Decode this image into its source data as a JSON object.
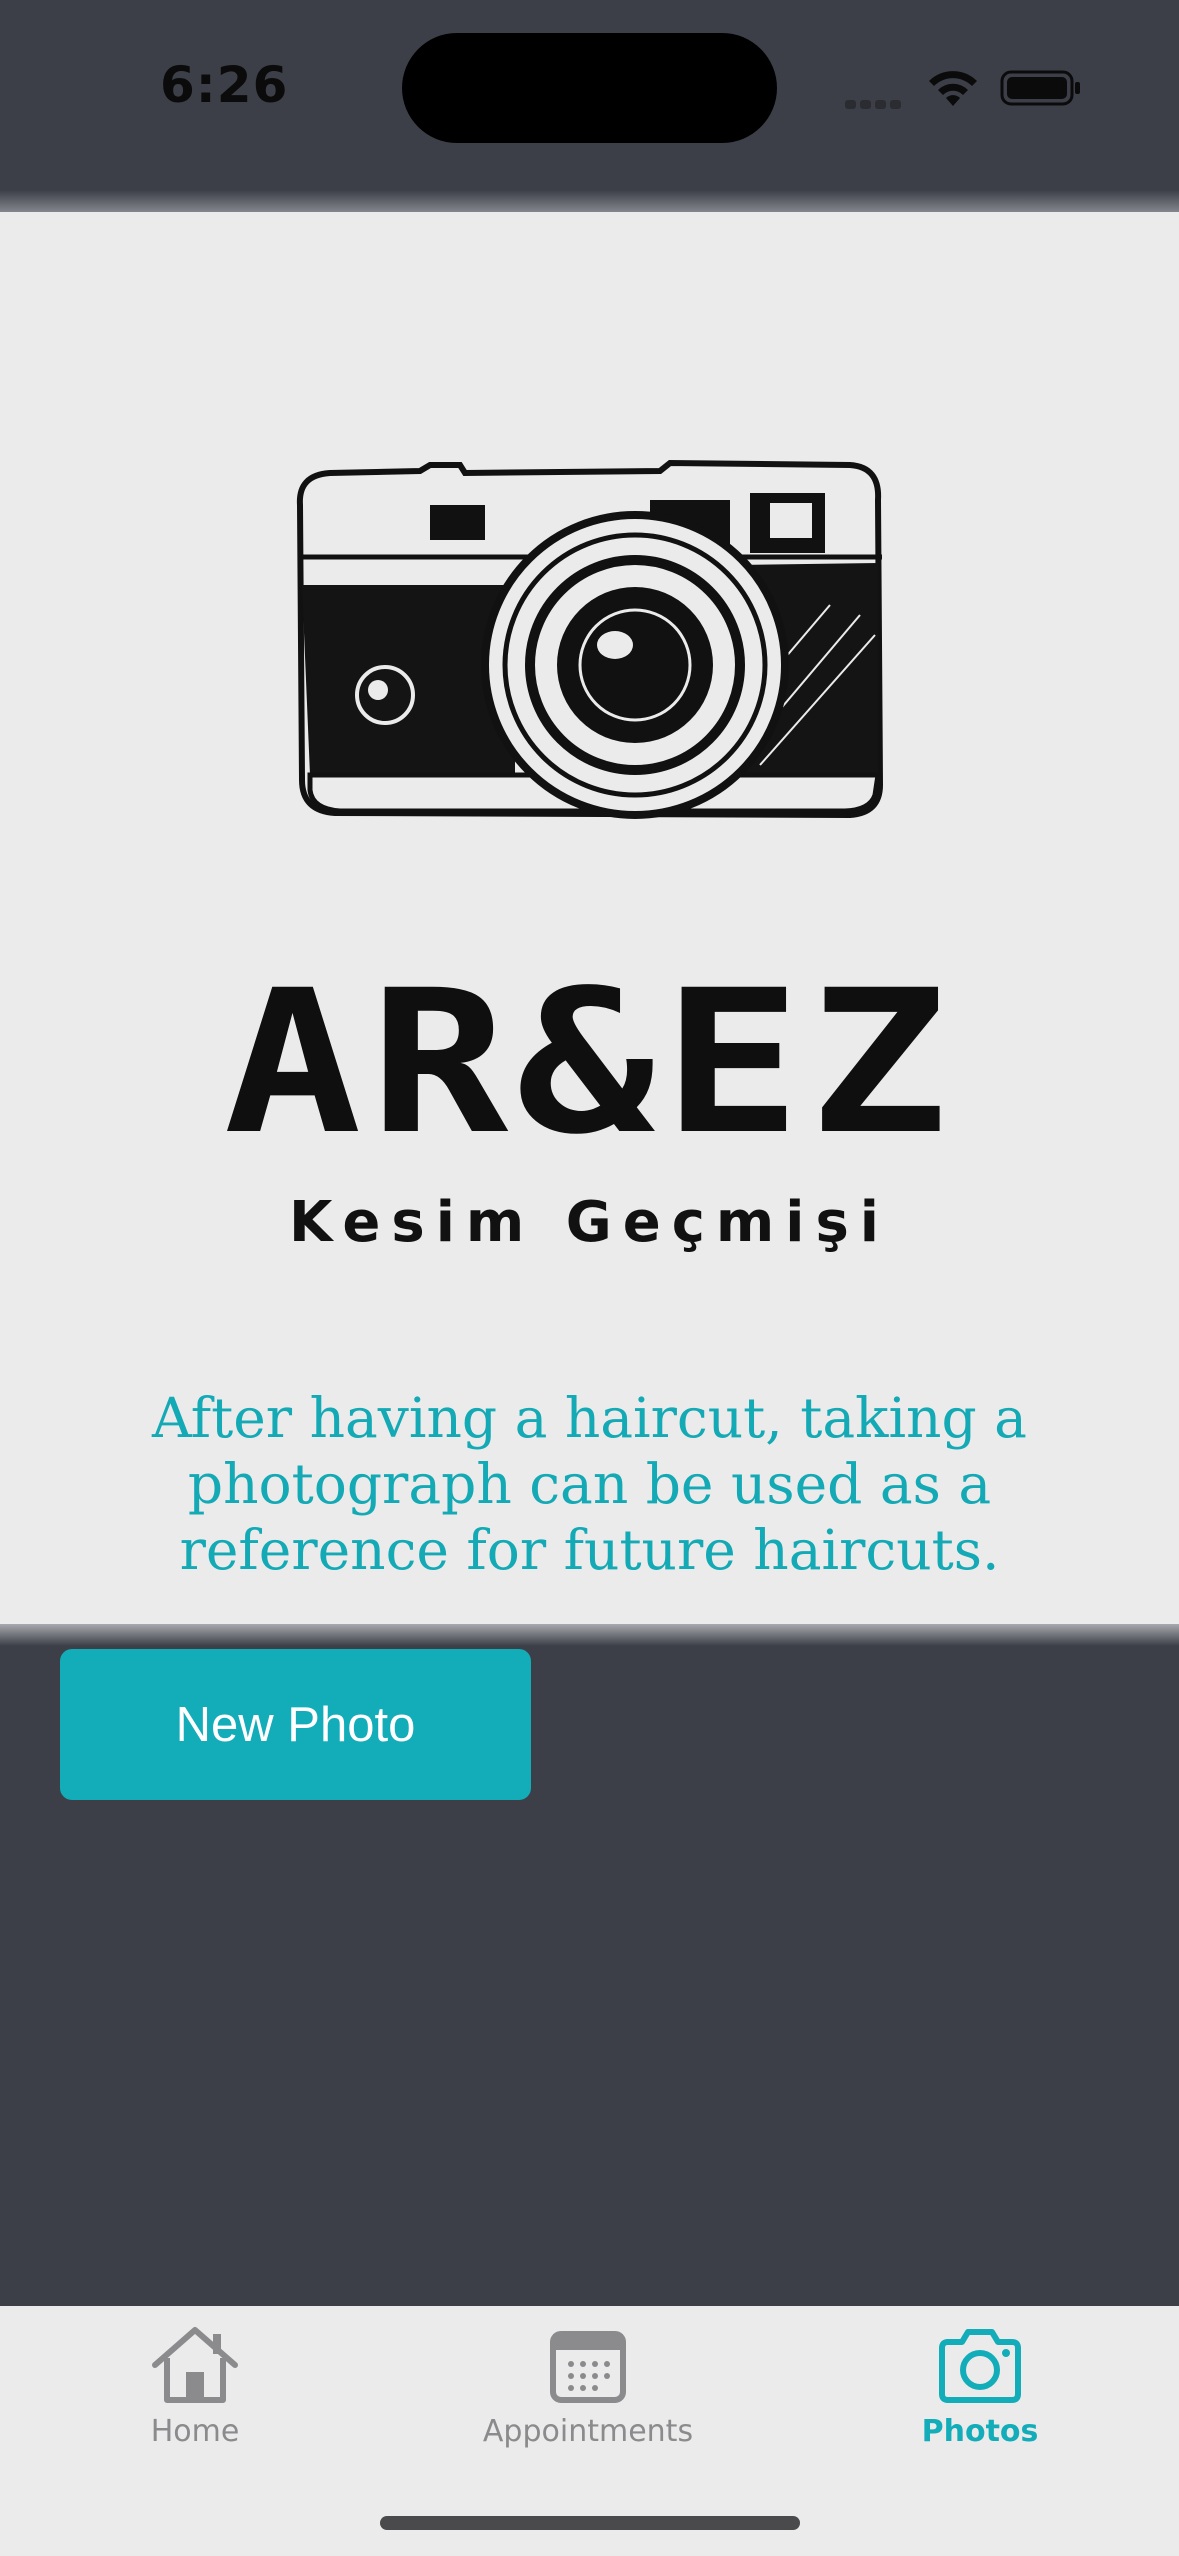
{
  "status_bar": {
    "time": "6:26"
  },
  "hero": {
    "brand_name": "AR&EZ",
    "brand_subtitle": "Kesim Geçmişi",
    "description": "After having a haircut, taking a photograph can be used as a reference for future haircuts."
  },
  "actions": {
    "new_photo_label": "New Photo"
  },
  "tab_bar": {
    "tabs": [
      {
        "label": "Home",
        "icon": "home-icon",
        "active": false
      },
      {
        "label": "Appointments",
        "icon": "calendar-icon",
        "active": false
      },
      {
        "label": "Photos",
        "icon": "camera-icon",
        "active": true
      }
    ]
  },
  "colors": {
    "accent": "#12adb9",
    "background_dark": "#3c3f48",
    "panel_light": "#ebebeb",
    "tab_inactive": "#8b8b8e"
  }
}
